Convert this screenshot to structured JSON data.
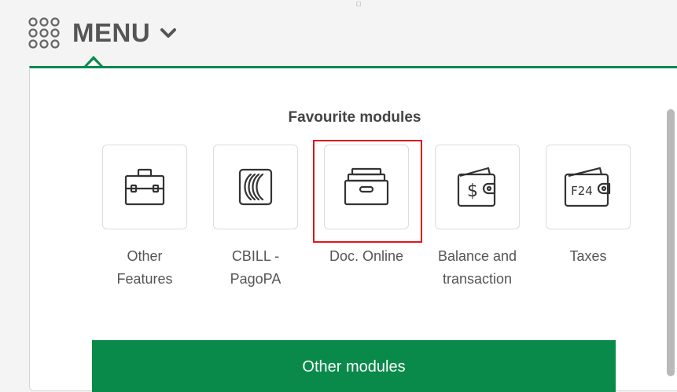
{
  "header": {
    "menu_label": "MENU",
    "menu_icon": "grid-dots-icon",
    "chevron_icon": "chevron-down-icon"
  },
  "panel": {
    "section_title": "Favourite modules",
    "modules": [
      {
        "label": "Other Features",
        "icon": "briefcase-icon"
      },
      {
        "label": "CBILL - PagoPA",
        "icon": "cbill-icon"
      },
      {
        "label": "Doc. Online",
        "icon": "archive-box-icon",
        "highlighted": true
      },
      {
        "label": "Balance and transaction",
        "icon": "wallet-dollar-icon"
      },
      {
        "label": "Taxes",
        "icon": "wallet-f24-icon",
        "icon_text": "F24"
      }
    ],
    "other_modules_label": "Other modules"
  },
  "colors": {
    "accent_green": "#0a8a4a",
    "highlight_red": "#e0161d",
    "text_gray": "#555555"
  }
}
